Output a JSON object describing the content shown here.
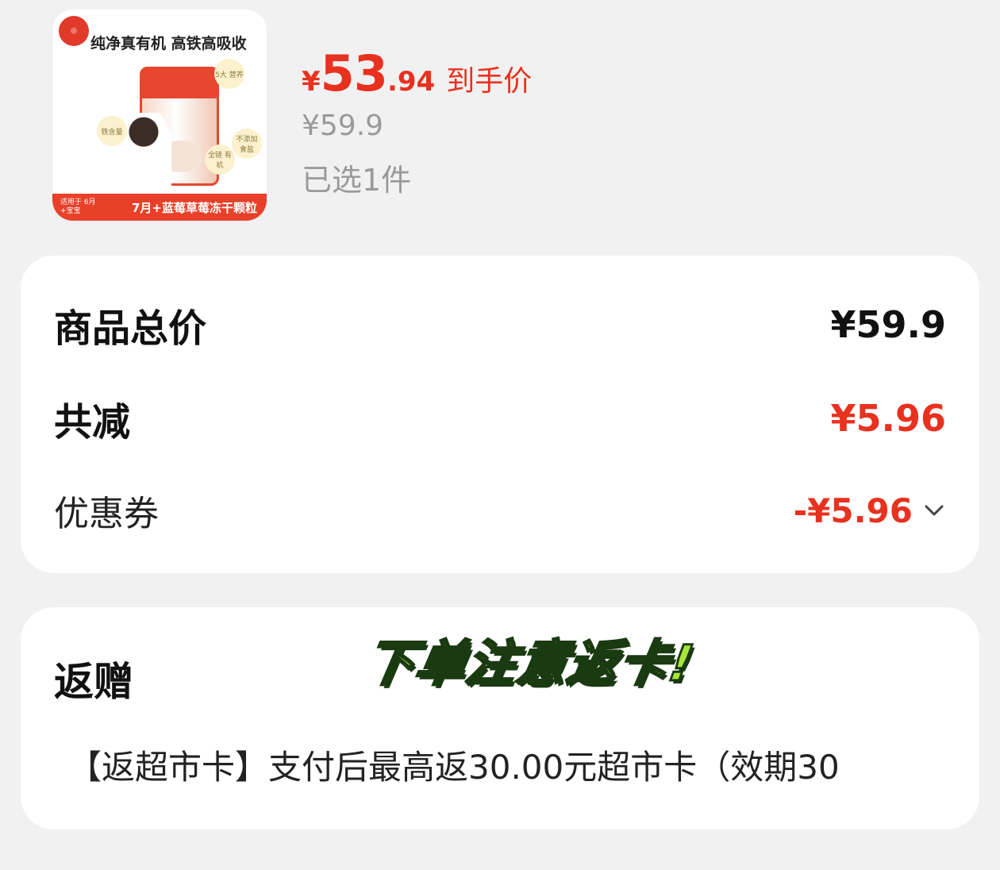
{
  "product": {
    "thumbnail_headline": "纯净真有机 高铁高吸收",
    "thumbnail_banner_small": "适用于 6月+宝宝",
    "thumbnail_banner": "7月+蓝莓草莓冻干颗粒",
    "thumbnail_bubbles": [
      "铁含量",
      "全链 有机",
      "不添加 食盐",
      "5大 营养"
    ],
    "price_symbol": "¥",
    "price_int": "53",
    "price_dec": ".94",
    "price_tag": "到手价",
    "original_price": "¥59.9",
    "selected_count": "已选1件"
  },
  "summary": {
    "total_label": "商品总价",
    "total_value": "¥59.9",
    "discount_label": "共减",
    "discount_value": "¥5.96",
    "coupon_label": "优惠券",
    "coupon_value": "-¥5.96"
  },
  "rebate": {
    "title": "返赠",
    "banner": "下单注意返卡!",
    "description": "【返超市卡】支付后最高返30.00元超市卡（效期30"
  },
  "colors": {
    "accent_red": "#e8311f",
    "muted_gray": "#9a9a9a",
    "banner_green": "#a8e63a",
    "background": "#f1f1f1"
  }
}
